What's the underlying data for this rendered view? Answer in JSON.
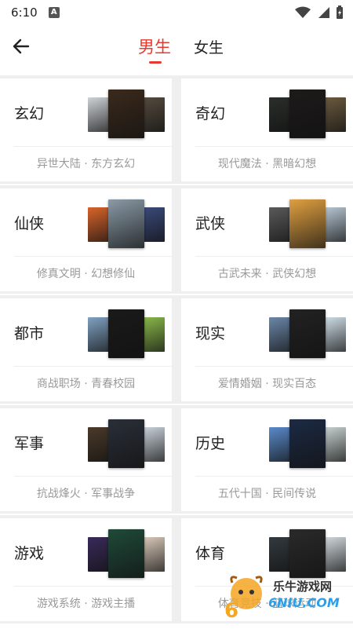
{
  "status_bar": {
    "time": "6:10",
    "notif_icon": "A"
  },
  "header": {
    "tabs": [
      "男生",
      "女生"
    ],
    "active_tab": "男生"
  },
  "colors": {
    "accent": "#e8392f",
    "tag_text": "#999999",
    "background_gap": "#efefef"
  },
  "categories": [
    {
      "name": "玄幻",
      "tags": "异世大陆 · 东方玄幻",
      "cover_colors": [
        "#cfd3d6",
        "#3b2a1c",
        "#554a3e"
      ]
    },
    {
      "name": "奇幻",
      "tags": "现代魔法 · 黑暗幻想",
      "cover_colors": [
        "#2a2f2b",
        "#1d1a1a",
        "#6b5a3e"
      ]
    },
    {
      "name": "仙侠",
      "tags": "修真文明 · 幻想修仙",
      "cover_colors": [
        "#d9642a",
        "#8a9aa6",
        "#3a4a7a"
      ]
    },
    {
      "name": "武侠",
      "tags": "古武未来 · 武侠幻想",
      "cover_colors": [
        "#5a5a5a",
        "#e0a040",
        "#b7c6d3"
      ]
    },
    {
      "name": "都市",
      "tags": "商战职场 · 青春校园",
      "cover_colors": [
        "#7fa1c2",
        "#1a1a1a",
        "#8ab84a"
      ]
    },
    {
      "name": "现实",
      "tags": "爱情婚姻 · 现实百态",
      "cover_colors": [
        "#6b87a8",
        "#222222",
        "#cfdde6"
      ]
    },
    {
      "name": "军事",
      "tags": "抗战烽火 · 军事战争",
      "cover_colors": [
        "#4a3a2a",
        "#2a2f38",
        "#c9d2da"
      ]
    },
    {
      "name": "历史",
      "tags": "五代十国 · 民间传说",
      "cover_colors": [
        "#5a8acb",
        "#1c2a44",
        "#c7d1cf"
      ]
    },
    {
      "name": "游戏",
      "tags": "游戏系统 · 游戏主播",
      "cover_colors": [
        "#3a2a5a",
        "#1f4a3a",
        "#d8c8b8"
      ]
    },
    {
      "name": "体育",
      "tags": "体育竞技 · 篮球运动",
      "cover_colors": [
        "#333a3f",
        "#2a2a2a",
        "#d0d8dc"
      ]
    }
  ],
  "watermark": {
    "text": "乐牛游戏网",
    "sub": "6NIU.COM"
  }
}
